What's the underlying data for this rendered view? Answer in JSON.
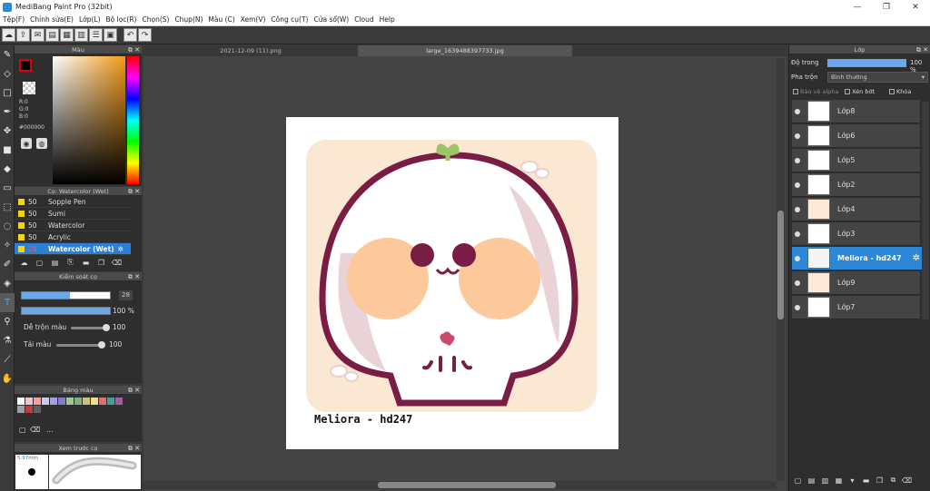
{
  "window": {
    "title": "MediBang Paint Pro (32bit)",
    "minimize": "—",
    "maximize": "❐",
    "close": "✕"
  },
  "menu": [
    "Tệp(F)",
    "Chỉnh sửa(E)",
    "Lớp(L)",
    "Bộ lọc(R)",
    "Chọn(S)",
    "Chụp(N)",
    "Màu (C)",
    "Xem(V)",
    "Công cụ(T)",
    "Cửa sổ(W)",
    "Cloud",
    "Help"
  ],
  "color_panel": {
    "title": "Màu",
    "r": "R:0",
    "g": "G:0",
    "b": "B:0",
    "hex": "#000000",
    "foreground": "#000000",
    "border": "#e00000"
  },
  "brush_panel": {
    "title": "Cọ: Watercolor (Wet)",
    "items": [
      {
        "size": "50",
        "name": "Sopple Pen"
      },
      {
        "size": "50",
        "name": "Sumi"
      },
      {
        "size": "50",
        "name": "Watercolor"
      },
      {
        "size": "50",
        "name": "Acrylic"
      },
      {
        "size": "28",
        "name": "Watercolor (Wet)",
        "selected": true
      }
    ]
  },
  "brush_control": {
    "title": "Kiểm soát cọ",
    "size": "28",
    "opacity": "100 %",
    "blend_label": "Dễ trộn màu",
    "blend_value": "100",
    "reload_label": "Tải màu",
    "reload_value": "100",
    "size_frac": 0.55,
    "opacity_frac": 1.0
  },
  "palette": {
    "title": "Bảng màu",
    "more": "...",
    "colors": [
      "#ffffff",
      "#e8c8c8",
      "#f0a0a0",
      "#c8c8f0",
      "#a0a0e8",
      "#8080c0",
      "#a0c8a0",
      "#80b080",
      "#c8c080",
      "#e8e090",
      "#e07070",
      "#40a0a0",
      "#a060a0",
      "#a0a0a0",
      "#c04040",
      "#606060"
    ]
  },
  "preview": {
    "title": "Xem trước cọ",
    "size": "5.97mm"
  },
  "tabs": [
    "2021-12-09 (11).png",
    "large_1639488397733.jpg"
  ],
  "canvas": {
    "signature": "Meliora - hd247"
  },
  "layers_panel": {
    "title": "Lớp",
    "opacity_label": "Độ trong",
    "opacity_value": "100 %",
    "blend_label": "Pha trộn",
    "blend_value": "Bình thường",
    "protect_alpha": "Bảo vệ alpha",
    "clipping": "Xén bớt",
    "lock": "Khóa",
    "layers": [
      {
        "name": "Lớp8"
      },
      {
        "name": "Lớp6"
      },
      {
        "name": "Lớp5"
      },
      {
        "name": "Lớp2"
      },
      {
        "name": "Lớp4"
      },
      {
        "name": "Lớp3"
      },
      {
        "name": "Meliora - hd247",
        "selected": true
      },
      {
        "name": "Lớp9"
      },
      {
        "name": "Lớp7"
      }
    ]
  }
}
